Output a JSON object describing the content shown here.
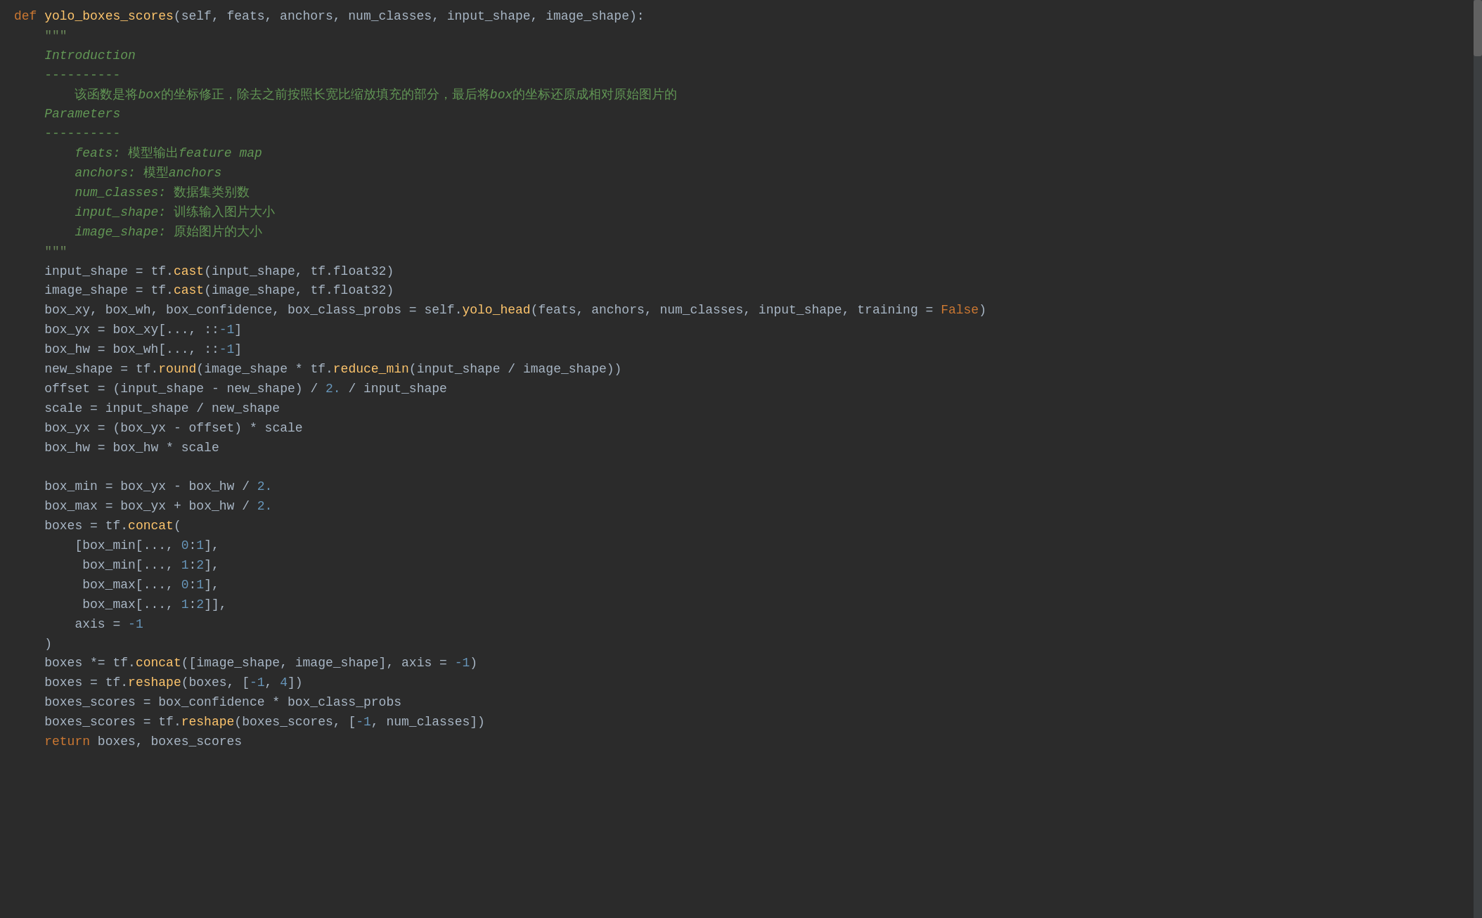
{
  "editor": {
    "background": "#2b2b2b",
    "lines": [
      {
        "id": 1,
        "content": "def_yolo_boxes_scores"
      },
      {
        "id": 2,
        "content": "    \"\"\""
      },
      {
        "id": 3,
        "content": "    Introduction"
      },
      {
        "id": 4,
        "content": "    ----------"
      },
      {
        "id": 5,
        "content": "        该函数是将box的坐标修正，除去之前按照长宽比缩放填充的部分，最后将box的坐标还原成相对原始图片的"
      },
      {
        "id": 6,
        "content": "    Parameters"
      },
      {
        "id": 7,
        "content": "    ----------"
      },
      {
        "id": 8,
        "content": "        feats: 模型输出feature map"
      },
      {
        "id": 9,
        "content": "        anchors: 模型anchors"
      },
      {
        "id": 10,
        "content": "        num_classes: 数据集类别数"
      },
      {
        "id": 11,
        "content": "        input_shape: 训练输入图片大小"
      },
      {
        "id": 12,
        "content": "        image_shape: 原始图片的大小"
      },
      {
        "id": 13,
        "content": "    \"\"\""
      },
      {
        "id": 14,
        "content": "    input_shape_cast"
      },
      {
        "id": 15,
        "content": "    image_shape_cast"
      },
      {
        "id": 16,
        "content": "    box_xy_etc"
      },
      {
        "id": 17,
        "content": "    box_yx"
      },
      {
        "id": 18,
        "content": "    box_hw"
      },
      {
        "id": 19,
        "content": "    new_shape"
      },
      {
        "id": 20,
        "content": "    offset"
      },
      {
        "id": 21,
        "content": "    scale"
      },
      {
        "id": 22,
        "content": "    box_yx2"
      },
      {
        "id": 23,
        "content": "    box_hw2"
      },
      {
        "id": 24,
        "content": "blank"
      },
      {
        "id": 25,
        "content": "    box_min"
      },
      {
        "id": 26,
        "content": "    box_max"
      },
      {
        "id": 27,
        "content": "    boxes_concat"
      },
      {
        "id": 28,
        "content": "    boxes_min1"
      },
      {
        "id": 29,
        "content": "    boxes_min2"
      },
      {
        "id": 30,
        "content": "    boxes_max1"
      },
      {
        "id": 31,
        "content": "    boxes_max2"
      },
      {
        "id": 32,
        "content": "    axis"
      },
      {
        "id": 33,
        "content": "    close_paren"
      },
      {
        "id": 34,
        "content": "    boxes_mul"
      },
      {
        "id": 35,
        "content": "    boxes_reshape"
      },
      {
        "id": 36,
        "content": "    boxes_scores1"
      },
      {
        "id": 37,
        "content": "    boxes_scores2"
      },
      {
        "id": 38,
        "content": "    return_stmt"
      }
    ]
  }
}
